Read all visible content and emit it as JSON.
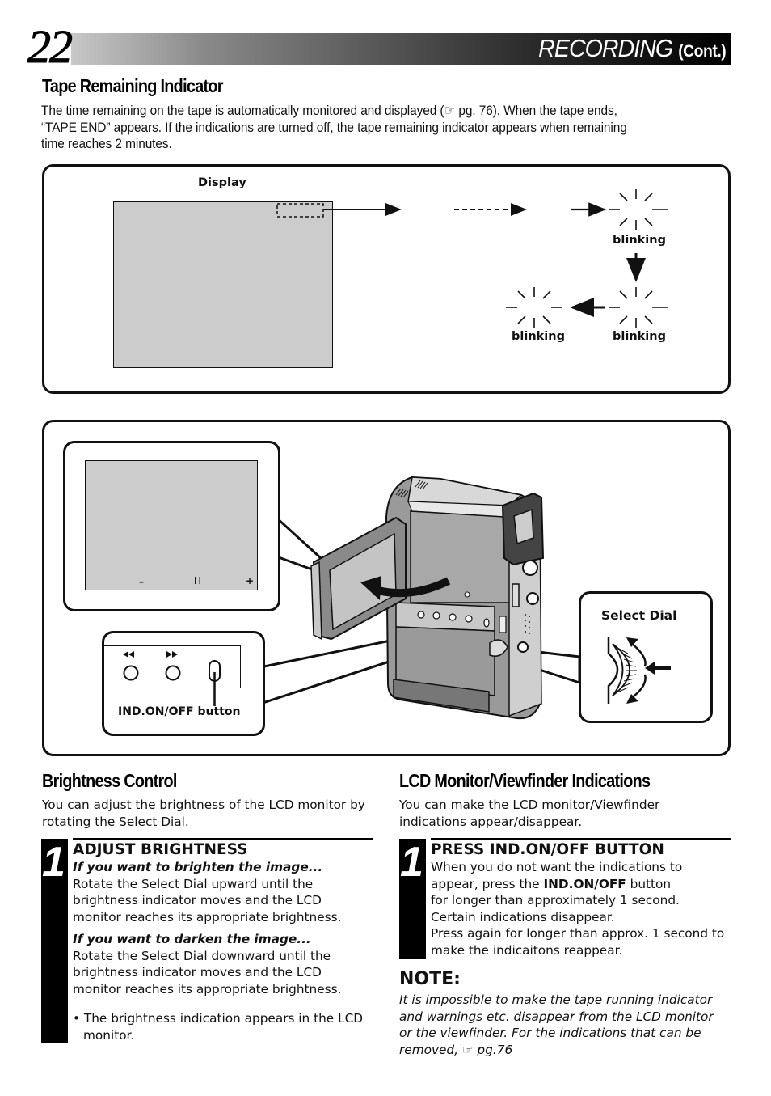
{
  "header": {
    "page_number": "22",
    "title": "RECORDING",
    "title_suffix": "(Cont.)"
  },
  "tape_remaining": {
    "heading": "Tape Remaining Indicator",
    "paragraph_lines": [
      "The time remaining on the tape is automatically monitored and displayed (☞ pg. 76). When the tape ends,",
      "“TAPE END” appears. If the indications are turned off, the tape remaining indicator appears when remaining",
      "time reaches 2 minutes."
    ],
    "figure": {
      "display_label": "Display",
      "blink_labels": [
        "blinking",
        "blinking",
        "blinking"
      ]
    }
  },
  "camera_figure": {
    "lcd_indicators": [
      "–",
      "❙❙",
      "+"
    ],
    "button_icons": [
      "rewind-icon ◀◀",
      "fast-forward-icon ▶▶"
    ],
    "ind_button_label": "IND.ON/OFF button",
    "select_dial_label": "Select Dial"
  },
  "brightness": {
    "heading": "Brightness Control",
    "intro_lines": [
      "You can adjust the brightness of the LCD monitor by",
      "rotating the Select Dial."
    ],
    "step": {
      "number": "1",
      "title": "ADJUST BRIGHTNESS",
      "brighten_heading": "If you want to brighten the image...",
      "brighten_lines": [
        "Rotate the Select Dial upward until the",
        "brightness indicator moves and the LCD",
        "monitor reaches its appropriate brightness."
      ],
      "darken_heading": "If you want to darken the image...",
      "darken_lines": [
        "Rotate the Select Dial downward until the",
        "brightness indicator moves and the LCD",
        "monitor reaches its appropriate brightness."
      ],
      "bullet_lines": [
        "• The brightness indication appears in the LCD",
        "monitor."
      ]
    }
  },
  "lcd_indications": {
    "heading": "LCD Monitor/Viewfinder Indications",
    "intro_lines": [
      "You can make the LCD monitor/Viewfinder",
      "indications appear/disappear."
    ],
    "step": {
      "number": "1",
      "title": "PRESS IND.ON/OFF BUTTON",
      "line1": "When you do not want the indications to",
      "line2_pre": "appear, press the ",
      "line2_bold": "IND.ON/OFF",
      "line2_post": " button",
      "line3": "for longer than approximately 1 second.",
      "line4": "Certain indications disappear.",
      "line5": "Press again for longer than approx. 1 second to",
      "line6": "make the indicaitons reappear."
    },
    "note": {
      "title": "NOTE:",
      "lines": [
        "It is impossible to make the tape running indicator",
        "and warnings etc. disappear from the LCD monitor",
        "or the viewfinder. For the indications that can be",
        "removed, ☞ pg.76"
      ]
    }
  }
}
